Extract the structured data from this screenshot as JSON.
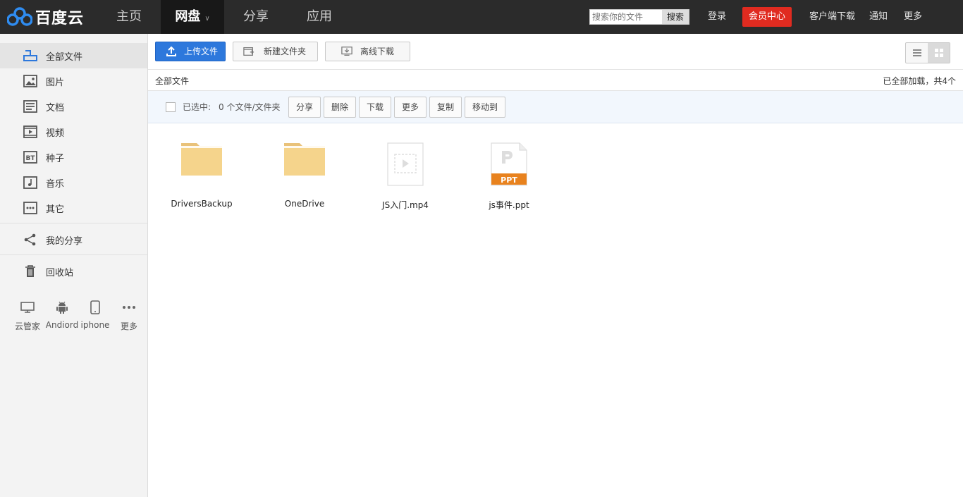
{
  "app": {
    "logo_text": "百度云"
  },
  "nav": {
    "home": "主页",
    "pan": "网盘",
    "share": "分享",
    "apps": "应用"
  },
  "search": {
    "placeholder": "搜索你的文件",
    "button": "搜索"
  },
  "header_links": {
    "login": "登录",
    "vip": "会员中心",
    "client_download": "客户端下载",
    "notify": "通知",
    "more": "更多"
  },
  "sidebar": {
    "items": [
      {
        "label": "全部文件",
        "icon": "all-files-icon"
      },
      {
        "label": "图片",
        "icon": "image-icon"
      },
      {
        "label": "文档",
        "icon": "document-icon"
      },
      {
        "label": "视频",
        "icon": "video-icon"
      },
      {
        "label": "种子",
        "icon": "bt-icon"
      },
      {
        "label": "音乐",
        "icon": "music-icon"
      },
      {
        "label": "其它",
        "icon": "other-icon"
      }
    ],
    "my_share": "我的分享",
    "recycle": "回收站",
    "devices": [
      {
        "label": "云管家",
        "icon": "desktop-icon"
      },
      {
        "label": "Andiord",
        "icon": "android-icon"
      },
      {
        "label": "iphone",
        "icon": "phone-icon"
      },
      {
        "label": "更多",
        "icon": "more-dots-icon"
      }
    ]
  },
  "toolbar": {
    "upload": "上传文件",
    "new_folder": "新建文件夹",
    "offline_download": "离线下载"
  },
  "breadcrumb": {
    "current": "全部文件",
    "status": "已全部加载，共4个"
  },
  "selection": {
    "label": "已选中:",
    "count": "0 个文件/文件夹",
    "actions": [
      "分享",
      "删除",
      "下载",
      "更多",
      "复制",
      "移动到"
    ]
  },
  "files": [
    {
      "name": "DriversBackup",
      "type": "folder"
    },
    {
      "name": "OneDrive",
      "type": "folder"
    },
    {
      "name": "JS入门.mp4",
      "type": "video"
    },
    {
      "name": "js事件.ppt",
      "type": "ppt",
      "badge": "PPT"
    }
  ],
  "colors": {
    "topbar": "#2b2b2b",
    "vip": "#e02b20",
    "primary": "#2d78dc",
    "folder": "#f5d48c",
    "ppt": "#e8821e"
  }
}
